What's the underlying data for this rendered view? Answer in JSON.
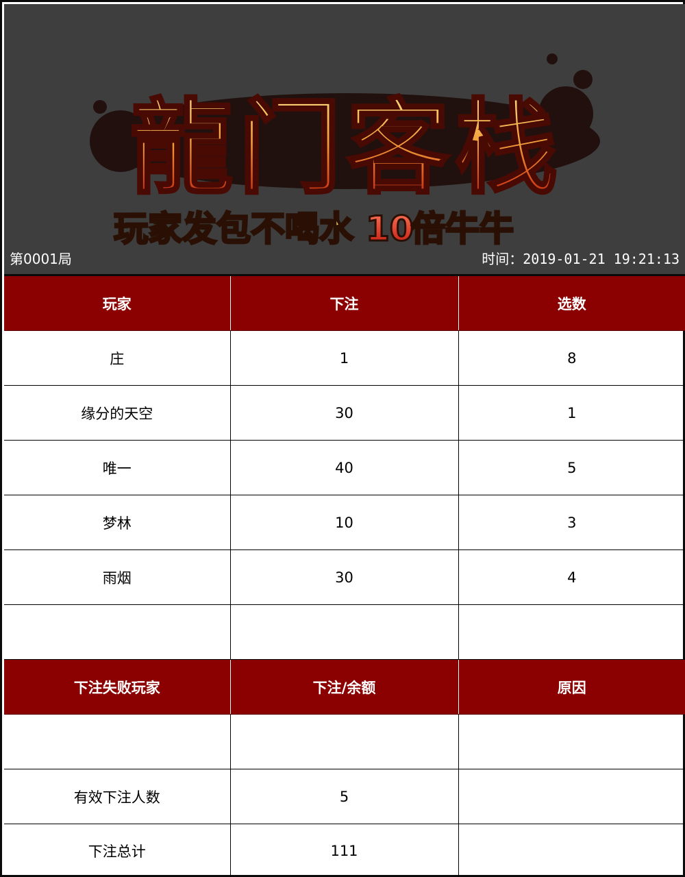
{
  "banner": {
    "logo_title": "龍门客栈",
    "subtitle_part1": "玩家发包不喝水",
    "subtitle_number": "10",
    "subtitle_part2": "倍牛牛",
    "round": "第0001局",
    "time_label": "时间：2019-01-21 19:21:13"
  },
  "bets_table": {
    "headers": [
      "玩家",
      "下注",
      "选数"
    ],
    "rows": [
      [
        "庄",
        "1",
        "8"
      ],
      [
        "缘分的天空",
        "30",
        "1"
      ],
      [
        "唯一",
        "40",
        "5"
      ],
      [
        "梦林",
        "10",
        "3"
      ],
      [
        "雨烟",
        "30",
        "4"
      ],
      [
        "",
        "",
        ""
      ]
    ]
  },
  "failed_table": {
    "headers": [
      "下注失败玩家",
      "下注/余额",
      "原因"
    ],
    "rows": [
      [
        "",
        "",
        ""
      ]
    ]
  },
  "summary": {
    "valid_bettors_label": "有效下注人数",
    "valid_bettors_value": "5",
    "total_label": "下注总计",
    "total_value": "111"
  },
  "colors": {
    "header_bg": "#8b0000",
    "banner_bg": "#3e3e3e",
    "logo_gold": "#f5c04a",
    "logo_red": "#c2240e",
    "subtitle_red": "#e0281c"
  }
}
